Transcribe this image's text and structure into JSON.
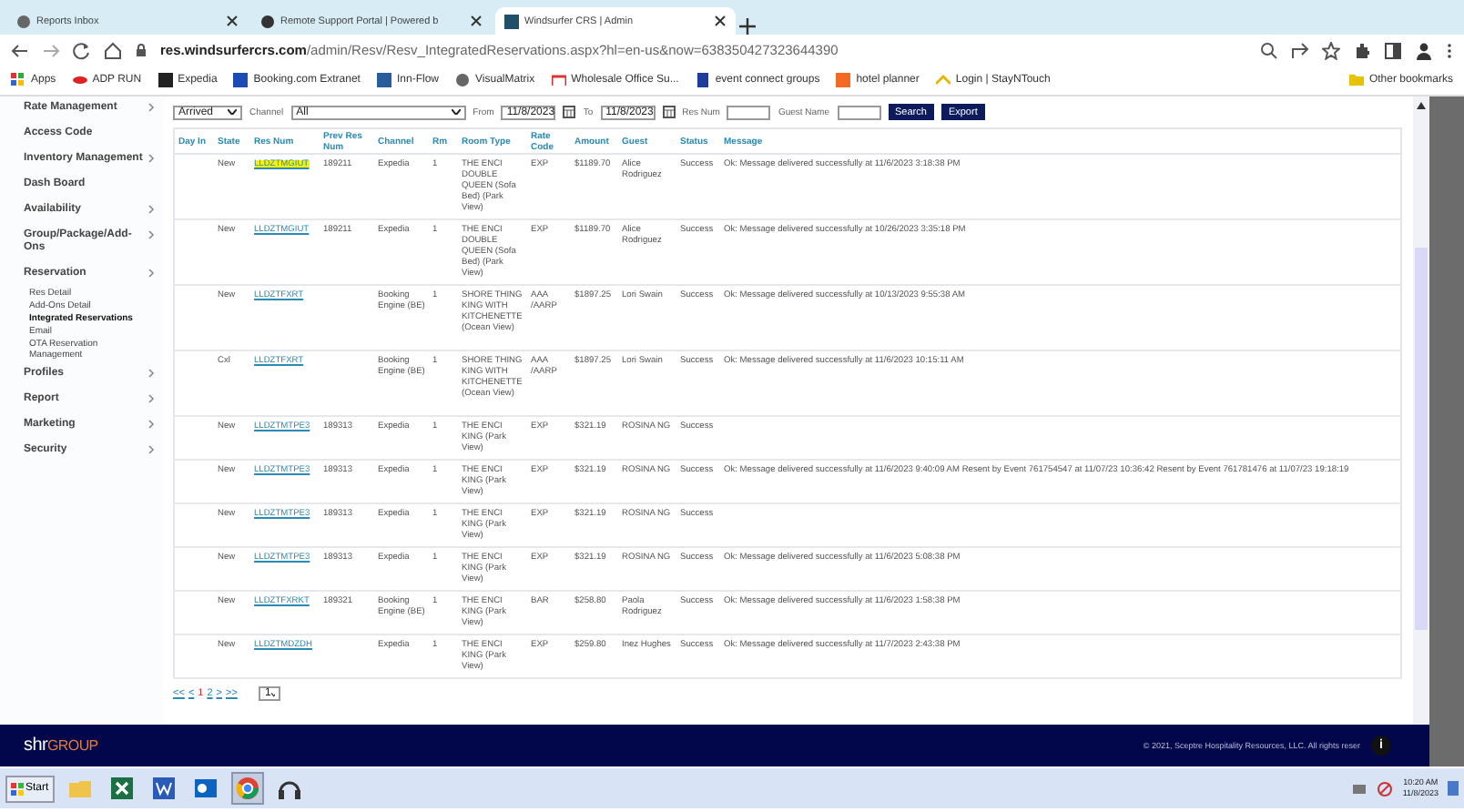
{
  "browser": {
    "tabs": [
      {
        "title": "Reports Inbox",
        "selected": false
      },
      {
        "title": "Remote Support Portal | Powered b",
        "selected": false
      },
      {
        "title": "Windsurfer CRS | Admin",
        "selected": true
      }
    ],
    "url_host": "res.windsurfercrs.com",
    "url_path": "/admin/Resv/Resv_IntegratedReservations.aspx?hl=en-us&now=638350427323644390",
    "bookmarks": [
      "Apps",
      "ADP RUN",
      "Expedia",
      "Booking.com Extranet",
      "Inn-Flow",
      "VisualMatrix",
      "Wholesale Office Su...",
      "event connect groups",
      "hotel planner",
      "Login | StayNTouch"
    ],
    "other_bookmarks": "Other bookmarks"
  },
  "sidebar": {
    "items": [
      {
        "label": "Rate Management",
        "has_submenu": true
      },
      {
        "label": "Access Code",
        "has_submenu": false
      },
      {
        "label": "Inventory Management",
        "has_submenu": true
      },
      {
        "label": "Dash Board",
        "has_submenu": false
      },
      {
        "label": "Availability",
        "has_submenu": true
      },
      {
        "label": "Group/Package/Add-Ons",
        "has_submenu": true
      },
      {
        "label": "Reservation",
        "has_submenu": true,
        "children": [
          {
            "label": "Res Detail",
            "selected": false
          },
          {
            "label": "Add-Ons Detail",
            "selected": false
          },
          {
            "label": "Integrated Reservations",
            "selected": true
          },
          {
            "label": "Email",
            "selected": false
          },
          {
            "label": "OTA Reservation Management",
            "selected": false
          }
        ]
      },
      {
        "label": "Profiles",
        "has_submenu": true
      },
      {
        "label": "Report",
        "has_submenu": true
      },
      {
        "label": "Marketing",
        "has_submenu": true
      },
      {
        "label": "Security",
        "has_submenu": true
      }
    ]
  },
  "filters": {
    "date_type": "Arrived",
    "channel_label": "Channel",
    "channel": "All",
    "from_label": "From",
    "from": "11/8/2023",
    "to_label": "To",
    "to": "11/8/2023",
    "res_num_label": "Res Num",
    "guest_name_label": "Guest Name",
    "buttons": [
      "Search",
      "Export"
    ]
  },
  "table": {
    "columns": [
      "Day In",
      "State",
      "Res Num",
      "Prev Res Num",
      "Channel",
      "Rm",
      "Room Type",
      "Rate Code",
      "Amount",
      "Guest",
      "Status",
      "Message"
    ],
    "rows": [
      {
        "cells": [
          "",
          "New",
          "LLDZTMGIUT",
          "189211",
          "Expedia",
          "1",
          "THE ENCI DOUBLE QUEEN (Sofa Bed) (Park View)",
          "EXP",
          "$1189.70",
          "Alice Rodriguez",
          "Success",
          "Ok: Message delivered successfully at 11/6/2023 3:18:38 PM"
        ],
        "highlighted": true
      },
      {
        "cells": [
          "",
          "New",
          "LLDZTMGIUT",
          "189211",
          "Expedia",
          "1",
          "THE ENCI DOUBLE QUEEN (Sofa Bed) (Park View)",
          "EXP",
          "$1189.70",
          "Alice Rodriguez",
          "Success",
          "Ok: Message delivered successfully at 10/26/2023 3:35:18 PM"
        ],
        "highlighted": false
      },
      {
        "cells": [
          "",
          "New",
          "LLDZTFXRT",
          "",
          "Booking Engine (BE)",
          "1",
          "SHORE THING KING WITH KITCHENETTE (Ocean View)",
          "AAA /AARP",
          "$1897.25",
          "Lori Swain",
          "Success",
          "Ok: Message delivered successfully at 10/13/2023 9:55:38 AM"
        ],
        "highlighted": false
      },
      {
        "cells": [
          "",
          "Cxl",
          "LLDZTFXRT",
          "",
          "Booking Engine (BE)",
          "1",
          "SHORE THING KING WITH KITCHENETTE (Ocean View)",
          "AAA /AARP",
          "$1897.25",
          "Lori Swain",
          "Success",
          "Ok: Message delivered successfully at 11/6/2023 10:15:11 AM"
        ],
        "highlighted": false
      },
      {
        "cells": [
          "",
          "New",
          "LLDZTMTPE3",
          "189313",
          "Expedia",
          "1",
          "THE ENCI KING (Park View)",
          "EXP",
          "$321.19",
          "ROSINA NG",
          "Success",
          ""
        ],
        "highlighted": false
      },
      {
        "cells": [
          "",
          "New",
          "LLDZTMTPE3",
          "189313",
          "Expedia",
          "1",
          "THE ENCI KING (Park View)",
          "EXP",
          "$321.19",
          "ROSINA NG",
          "Success",
          "Ok: Message delivered successfully at 11/6/2023 9:40:09 AM Resent by Event 761754547 at 11/07/23 10:36:42 Resent by Event 761781476 at 11/07/23 19:18:19"
        ],
        "highlighted": false
      },
      {
        "cells": [
          "",
          "New",
          "LLDZTMTPE3",
          "189313",
          "Expedia",
          "1",
          "THE ENCI KING (Park View)",
          "EXP",
          "$321.19",
          "ROSINA NG",
          "Success",
          ""
        ],
        "highlighted": false
      },
      {
        "cells": [
          "",
          "New",
          "LLDZTMTPE3",
          "189313",
          "Expedia",
          "1",
          "THE ENCI KING (Park View)",
          "EXP",
          "$321.19",
          "ROSINA NG",
          "Success",
          "Ok: Message delivered successfully at 11/6/2023 5:08:38 PM"
        ],
        "highlighted": false
      },
      {
        "cells": [
          "",
          "New",
          "LLDZTFXRKT",
          "189321",
          "Booking Engine (BE)",
          "1",
          "THE ENCI KING (Park View)",
          "BAR",
          "$258.80",
          "Paola Rodriguez",
          "Success",
          "Ok: Message delivered successfully at 11/6/2023 1:58:38 PM"
        ],
        "highlighted": false
      },
      {
        "cells": [
          "",
          "New",
          "LLDZTMDZDH",
          "",
          "Expedia",
          "1",
          "THE ENCI KING (Park View)",
          "EXP",
          "$259.80",
          "Inez Hughes",
          "Success",
          "Ok: Message delivered successfully at 11/7/2023 2:43:38 PM"
        ],
        "highlighted": false
      }
    ]
  },
  "pager": {
    "links": [
      {
        "label": "<<",
        "selected": false
      },
      {
        "label": "<",
        "selected": false
      },
      {
        "label": "1",
        "selected": true
      },
      {
        "label": "2",
        "selected": false
      },
      {
        "label": ">",
        "selected": false
      },
      {
        "label": ">>",
        "selected": false
      }
    ],
    "page_select": "1"
  },
  "footer": {
    "logo_main": "shr",
    "logo_sub": "GROUP",
    "copyright": "© 2021, Sceptre Hospitality Resources, LLC. All rights reser",
    "info": "i"
  },
  "taskbar": {
    "start": "Start",
    "time": "10:20 AM",
    "date": "11/8/2023"
  }
}
